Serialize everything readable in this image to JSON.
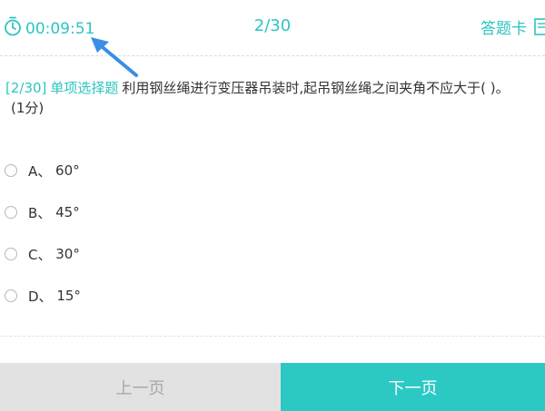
{
  "header": {
    "timer": "00:09:51",
    "progress": "2/30",
    "answer_card_label": "答题卡"
  },
  "question": {
    "index": "[2/30]",
    "type": "单项选择题",
    "text": "利用钢丝绳进行变压器吊装时,起吊钢丝绳之间夹角不应大于( )。",
    "score": "(1分)"
  },
  "options": [
    {
      "letter": "A、",
      "value": "60°"
    },
    {
      "letter": "B、",
      "value": "45°"
    },
    {
      "letter": "C、",
      "value": "30°"
    },
    {
      "letter": "D、",
      "value": "15°"
    }
  ],
  "footer": {
    "prev_label": "上一页",
    "next_label": "下一页"
  },
  "colors": {
    "accent": "#2cc5c1",
    "arrow": "#3a8ee6",
    "prev_bg": "#e2e2e2",
    "next_bg": "#2cc9c4"
  },
  "icons": {
    "timer": "stopwatch-icon",
    "answer_card": "answer-card-icon",
    "pointer": "annotation-arrow"
  }
}
